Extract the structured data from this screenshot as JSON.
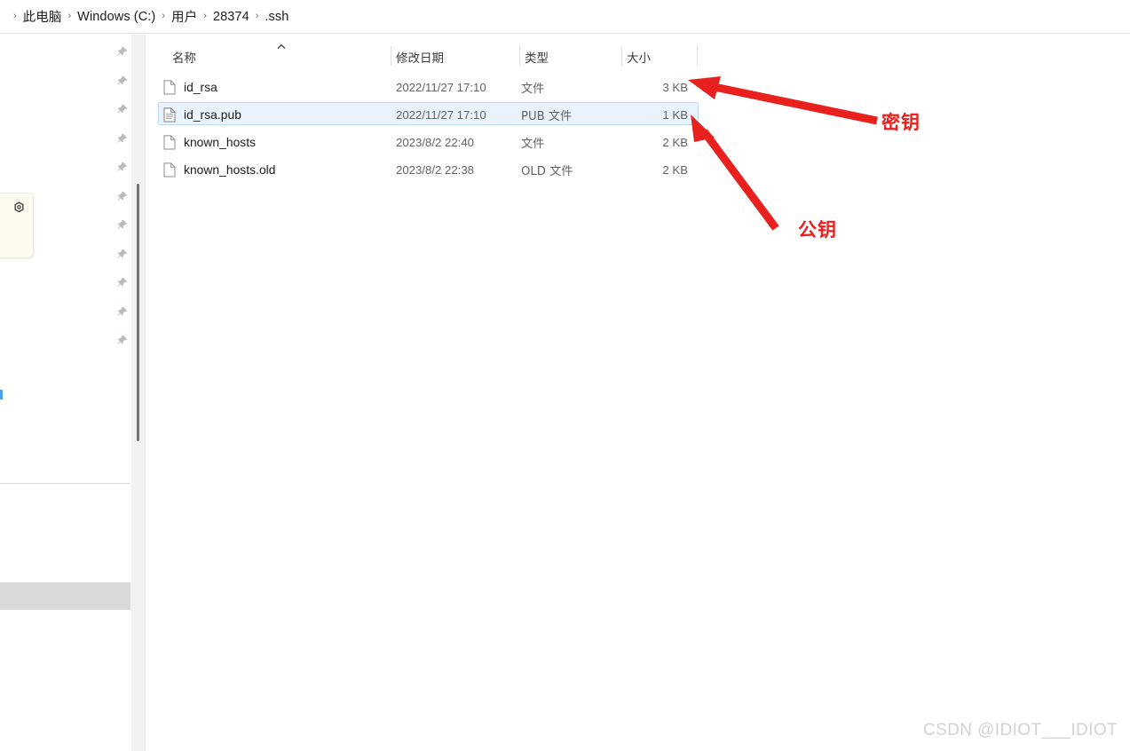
{
  "breadcrumb": {
    "name": "address-breadcrumb",
    "separator": "›",
    "items": [
      {
        "label": "此电脑"
      },
      {
        "label": "Windows (C:)"
      },
      {
        "label": "用户"
      },
      {
        "label": "28374"
      },
      {
        "label": ".ssh"
      }
    ]
  },
  "file_list": {
    "sort_indicator": "ascending",
    "columns": [
      {
        "key": "name",
        "label": "名称"
      },
      {
        "key": "date",
        "label": "修改日期"
      },
      {
        "key": "type",
        "label": "类型"
      },
      {
        "key": "size",
        "label": "大小"
      }
    ],
    "rows": [
      {
        "name": "id_rsa",
        "date": "2022/11/27 17:10",
        "type": "文件",
        "size": "3 KB",
        "icon": "blank-file-icon",
        "selected": false
      },
      {
        "name": "id_rsa.pub",
        "date": "2022/11/27 17:10",
        "type": "PUB 文件",
        "size": "1 KB",
        "icon": "text-file-icon",
        "selected": true
      },
      {
        "name": "known_hosts",
        "date": "2023/8/2 22:40",
        "type": "文件",
        "size": "2 KB",
        "icon": "blank-file-icon",
        "selected": false
      },
      {
        "name": "known_hosts.old",
        "date": "2023/8/2 22:38",
        "type": "OLD 文件",
        "size": "2 KB",
        "icon": "blank-file-icon",
        "selected": false
      }
    ]
  },
  "annotations": {
    "color": "#e8201e",
    "private_key_label": "密钥",
    "public_key_label": "公钥"
  },
  "watermark": {
    "text": "CSDN @IDIOT___IDIOT",
    "color": "#d2d2d2"
  },
  "left_pane": {
    "pin_count": 11,
    "pin_icon": "pin-icon",
    "note_icon": "gear-hex-icon"
  },
  "colors": {
    "selection_bg": "#eaf3fd",
    "selection_border": "#bcdcf7",
    "annotation_red": "#e8201e",
    "scrollbar_thumb": "#757575"
  }
}
